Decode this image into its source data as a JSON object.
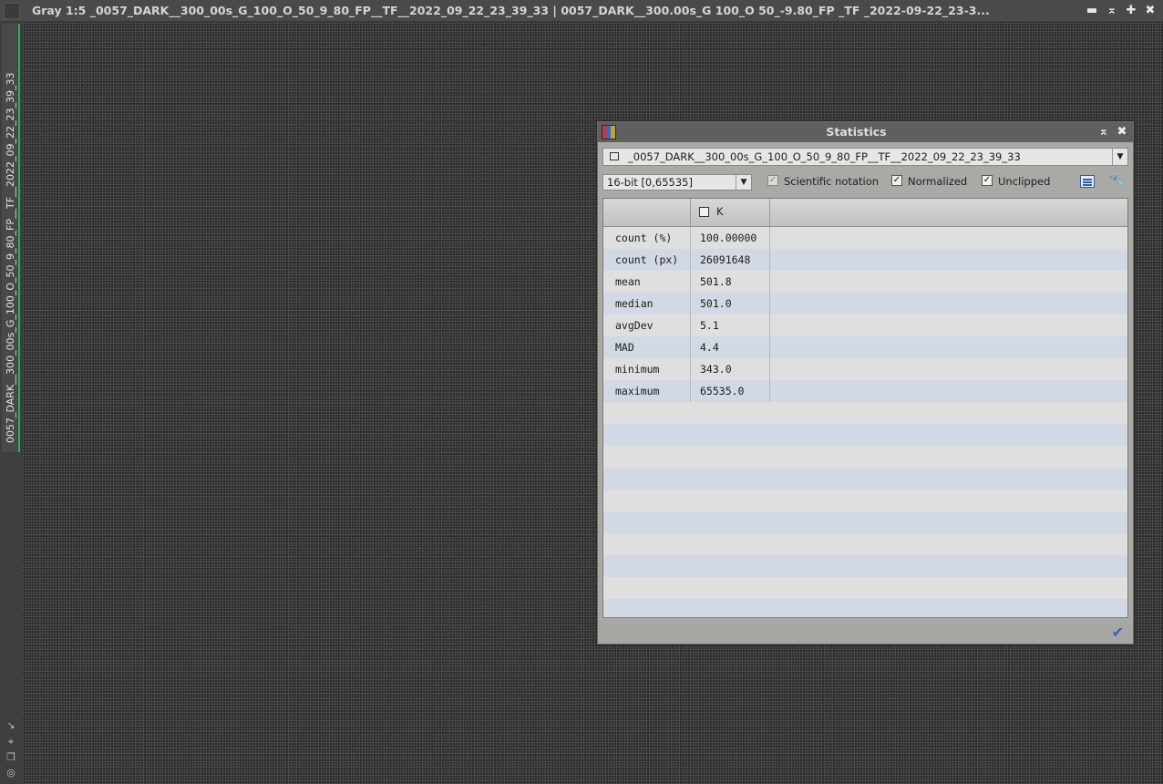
{
  "window": {
    "title": "Gray 1:5 _0057_DARK__300_00s_G_100_O_50_9_80_FP__TF__2022_09_22_23_39_33 | 0057_DARK__300.00s_G 100_O 50_-9.80_FP _TF _2022-09-22_23-3...",
    "controls": {
      "minimize": "▬",
      "shade": "⌅",
      "maximize": "✚",
      "close": "✖"
    }
  },
  "left_strip": {
    "tab_label": "0057_DARK__300_00s_G_100_O_50_9_80_FP__TF__2022_09_22_23_39_33",
    "icons": [
      "arrow-down-right-icon",
      "crosshair-icon",
      "windows-icon",
      "target-icon"
    ]
  },
  "statistics": {
    "title": "Statistics",
    "controls": {
      "shade": "⌅",
      "close": "✖"
    },
    "view_select": "_0057_DARK__300_00s_G_100_O_50_9_80_FP__TF__2022_09_22_23_39_33",
    "range_select": "16-bit [0,65535]",
    "options": {
      "scientific_notation": {
        "label": "Scientific notation",
        "checked": true,
        "enabled": false
      },
      "normalized": {
        "label": "Normalized",
        "checked": true,
        "enabled": true
      },
      "unclipped": {
        "label": "Unclipped",
        "checked": true,
        "enabled": true
      }
    },
    "check_glyph": "✓",
    "column_header": "K",
    "rows": [
      {
        "name": "count (%)",
        "value": "100.00000"
      },
      {
        "name": "count (px)",
        "value": "26091648"
      },
      {
        "name": "mean",
        "value": "501.8"
      },
      {
        "name": "median",
        "value": "501.0"
      },
      {
        "name": "avgDev",
        "value": "5.1"
      },
      {
        "name": "MAD",
        "value": "4.4"
      },
      {
        "name": "minimum",
        "value": "343.0"
      },
      {
        "name": "maximum",
        "value": "65535.0"
      }
    ],
    "ok_glyph": "✔"
  }
}
